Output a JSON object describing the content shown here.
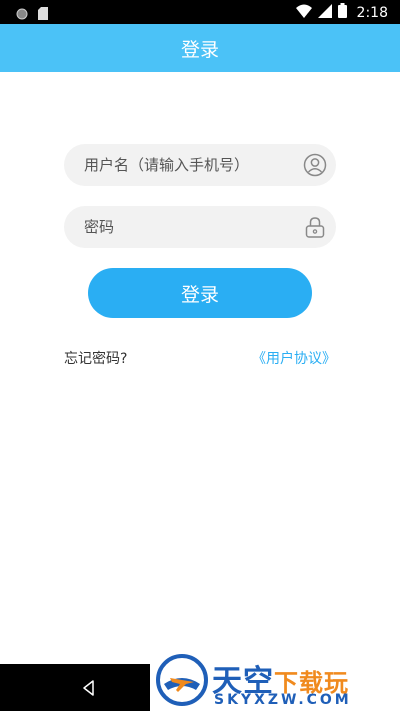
{
  "status_bar": {
    "time": "2:18"
  },
  "app_bar": {
    "title": "登录"
  },
  "form": {
    "username_placeholder": "用户名（请输入手机号）",
    "username_icon": "person-circle-icon",
    "password_placeholder": "密码",
    "password_icon": "lock-icon",
    "login_label": "登录"
  },
  "links": {
    "forgot": "忘记密码?",
    "agreement": "《用户协议》"
  },
  "watermark": {
    "main": "天空",
    "accent": "下载玩",
    "sub": "SKYXZW.COM"
  },
  "colors": {
    "accent": "#4bc2f7",
    "button": "#2aaef3",
    "link": "#2aaef3",
    "field_bg": "#f2f2f2"
  }
}
